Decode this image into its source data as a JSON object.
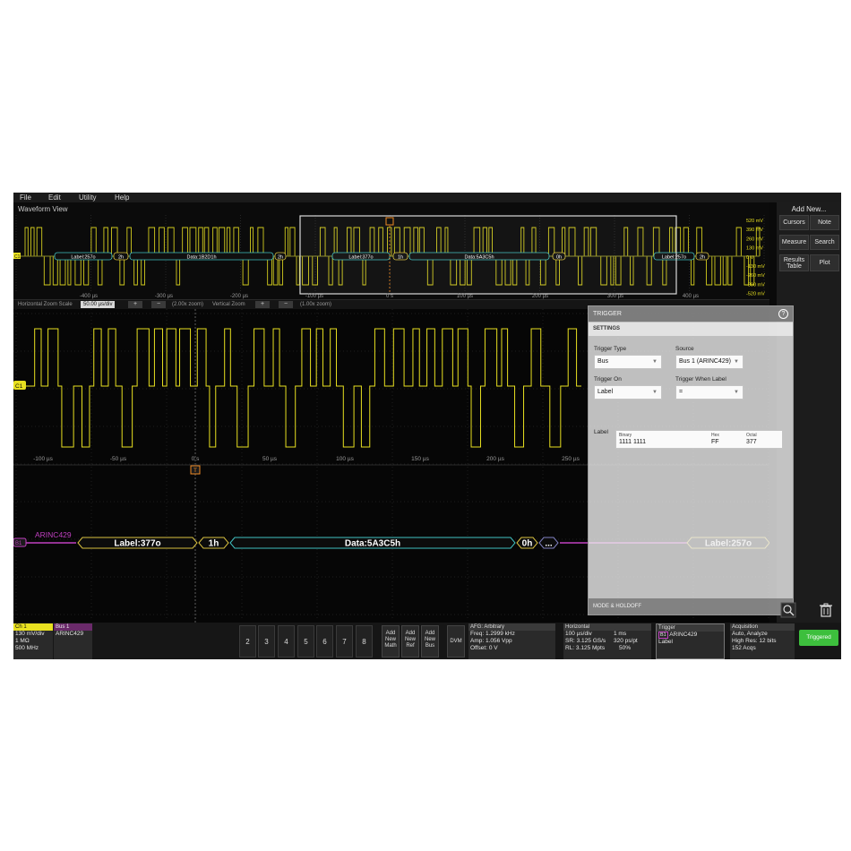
{
  "menu": [
    "File",
    "Edit",
    "Utility",
    "Help"
  ],
  "overview": {
    "title": "Waveform View",
    "time_ticks": [
      "-400 µs",
      "-300 µs",
      "-200 µs",
      "-100 µs",
      "0 s",
      "100 µs",
      "200 µs",
      "300 µs",
      "400 µs"
    ],
    "volt_labels": [
      "520 mV",
      "390 mV",
      "260 mV",
      "130 mV",
      "0 V",
      "-130 mV",
      "-260 mV",
      "-390 mV",
      "-520 mV"
    ],
    "bus_segments": [
      "Label:257o",
      "2h",
      "Data:1B2D1h",
      "2h",
      "Label:377o",
      "1h",
      "Data:5A3C5h",
      "0h",
      "Label:257o",
      "2h"
    ]
  },
  "zoom": {
    "h_label": "Horizontal Zoom Scale",
    "h_value": "50.00 µs/div",
    "h_factor": "(2.00x zoom)",
    "v_label": "Vertical Zoom",
    "v_factor": "(1.00x zoom)"
  },
  "main": {
    "ch_marker": "C1",
    "trigger_marker": "T",
    "time_ticks": [
      "-100 µs",
      "-50 µs",
      "0 s",
      "50 µs",
      "100 µs",
      "150 µs",
      "200 µs",
      "250 µs"
    ],
    "bus_marker": "B1",
    "bus_name": "ARINC429",
    "bus_segments": [
      "Label:377o",
      "1h",
      "Data:5A3C5h",
      "0h",
      "...",
      "Label:257o"
    ]
  },
  "side_panel": {
    "title": "Add New...",
    "buttons": [
      "Cursors",
      "Note",
      "Measure",
      "Search",
      "Results Table",
      "Plot"
    ]
  },
  "trigger_panel": {
    "title": "TRIGGER",
    "help": "?",
    "section": "SETTINGS",
    "type_label": "Trigger Type",
    "type_value": "Bus",
    "source_label": "Source",
    "source_value": "Bus 1 (ARINC429)",
    "on_label": "Trigger On",
    "on_value": "Label",
    "when_label": "Trigger When Label",
    "when_value": "=",
    "label_label": "Label",
    "binary_label": "Binary",
    "binary_value": "1111  1111",
    "hex_label": "Hex",
    "hex_value": "FF",
    "octal_label": "Octal",
    "octal_value": "377",
    "footer": "MODE & HOLDOFF"
  },
  "bottom": {
    "ch1": {
      "head": "Ch 1",
      "lines": [
        "130 mV/div",
        "1 MΩ",
        "500 MHz"
      ]
    },
    "bus1": {
      "head": "Bus 1",
      "lines": [
        "ARINC429"
      ]
    },
    "channels": [
      "2",
      "3",
      "4",
      "5",
      "6",
      "7",
      "8"
    ],
    "add_buttons": [
      {
        "l1": "Add",
        "l2": "New",
        "l3": "Math"
      },
      {
        "l1": "Add",
        "l2": "New",
        "l3": "Ref"
      },
      {
        "l1": "Add",
        "l2": "New",
        "l3": "Bus"
      }
    ],
    "dvm": "DVM",
    "afg": {
      "head": "AFG: Arbitrary",
      "lines": [
        "Freq: 1.2999 kHz",
        "Amp: 1.056 Vpp",
        "Offset: 0 V"
      ]
    },
    "horizontal": {
      "head": "Horizontal",
      "lines": [
        "100 µs/div",
        "SR: 3.125 GS/s",
        "RL: 3.125 Mpts"
      ],
      "lines_r": [
        "1 ms",
        "320 ps/pt",
        "50%"
      ]
    },
    "trigger": {
      "head": "Trigger",
      "bus": "B1",
      "lines": [
        "ARINC429",
        "Label"
      ]
    },
    "acquisition": {
      "head": "Acquisition",
      "lines": [
        "Auto,    Analyze",
        "High Res: 12 bits",
        "152 Acqs"
      ]
    },
    "triggered": "Triggered"
  },
  "colors": {
    "ch1": "#e8e020",
    "bus1": "#c040c0",
    "trigger": "#f08a24",
    "triggered": "#3dbf3d",
    "bus_text": "#ffffff"
  }
}
